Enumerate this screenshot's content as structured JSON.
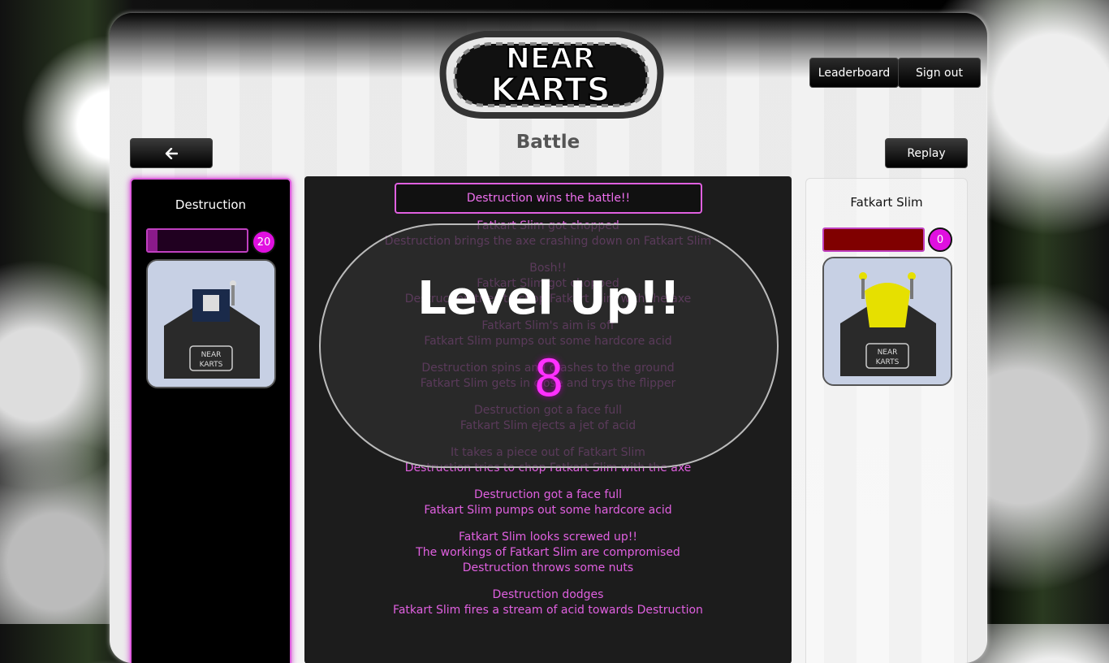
{
  "header": {
    "logo_line1": "NEAR",
    "logo_line2": "KARTS",
    "leaderboard_label": "Leaderboard",
    "signout_label": "Sign out"
  },
  "page": {
    "title": "Battle",
    "back_icon": "arrow-left-icon",
    "replay_label": "Replay"
  },
  "player": {
    "name": "Destruction",
    "level": "20",
    "health_fraction": 0.1,
    "accent_color": "#e060e0"
  },
  "opponent": {
    "name": "Fatkart Slim",
    "level": "0",
    "health_fraction": 1.0,
    "accent_color": "#800000"
  },
  "battle": {
    "result": "Destruction wins the battle!!",
    "log": [
      [
        "Fatkart Slim got chopped",
        "Destruction brings the axe crashing down on Fatkart Slim"
      ],
      [
        "Bosh!!",
        "Fatkart Slim got chopped",
        "Destruction tries to chop Fatkart Slim with the axe"
      ],
      [
        "Fatkart Slim's aim is off",
        "Fatkart Slim pumps out some hardcore acid"
      ],
      [
        "Destruction spins and crashes to the ground",
        "Fatkart Slim gets in close and trys the flipper"
      ],
      [
        "Destruction got a face full",
        "Fatkart Slim ejects a jet of acid"
      ],
      [
        "It takes a piece out of Fatkart Slim",
        "Destruction tries to chop Fatkart Slim with the axe"
      ],
      [
        "Destruction got a face full",
        "Fatkart Slim pumps out some hardcore acid"
      ],
      [
        "Fatkart Slim looks screwed up!!",
        "The workings of Fatkart Slim are compromised",
        "Destruction throws some nuts"
      ],
      [
        "Destruction dodges",
        "Fatkart Slim fires a stream of acid towards Destruction"
      ]
    ]
  },
  "levelup": {
    "title": "Level Up!!",
    "level": "8"
  },
  "kart_img_text": {
    "line1": "NEAR",
    "line2": "KARTS"
  }
}
